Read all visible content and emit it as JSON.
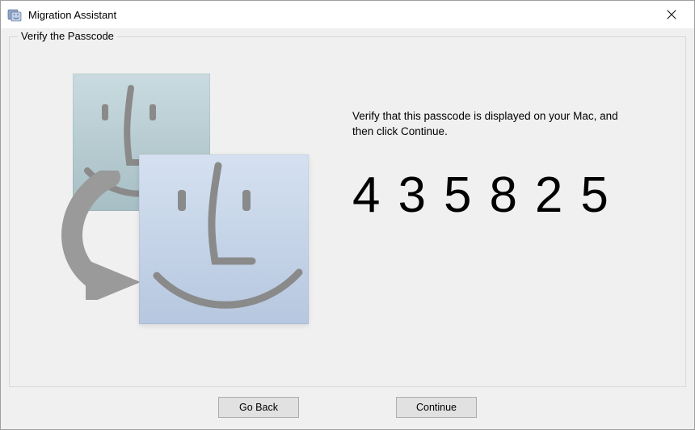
{
  "window": {
    "title": "Migration Assistant",
    "close_tooltip": "Close"
  },
  "group": {
    "legend": "Verify the Passcode"
  },
  "main": {
    "instruction": "Verify that this passcode is displayed on your Mac, and then click Continue.",
    "passcode": "435825"
  },
  "buttons": {
    "back": "Go Back",
    "continue": "Continue"
  },
  "illustration": {
    "alt": "Two Finder-face icons with transfer arrow"
  }
}
